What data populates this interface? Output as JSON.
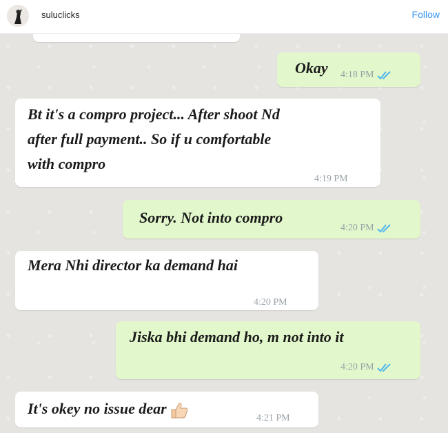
{
  "header": {
    "username": "suluclicks",
    "follow_label": "Follow"
  },
  "messages": [
    {
      "direction": "out",
      "text": "Okay",
      "time": "4:18 PM",
      "read": true
    },
    {
      "direction": "in",
      "lines": [
        "Bt it's a compro project... After shoot Nd",
        "after full payment.. So if u comfortable",
        "with compro"
      ],
      "time": "4:19 PM"
    },
    {
      "direction": "out",
      "text": "Sorry. Not into compro",
      "time": "4:20 PM",
      "read": true
    },
    {
      "direction": "in",
      "text": "Mera Nhi director ka demand hai",
      "time": "4:20 PM"
    },
    {
      "direction": "out",
      "text": "Jiska bhi demand ho, m not into it",
      "time": "4:20 PM",
      "read": true
    },
    {
      "direction": "in",
      "text": "It's okey no issue dear",
      "time": "4:21 PM",
      "emoji": "thumbs-up-icon"
    }
  ],
  "colors": {
    "incoming_bubble": "#ffffff",
    "outgoing_bubble": "#e2f7cb",
    "read_tick": "#4fb6ec",
    "follow_link": "#3897f0",
    "chat_background": "#e6e4e0"
  }
}
